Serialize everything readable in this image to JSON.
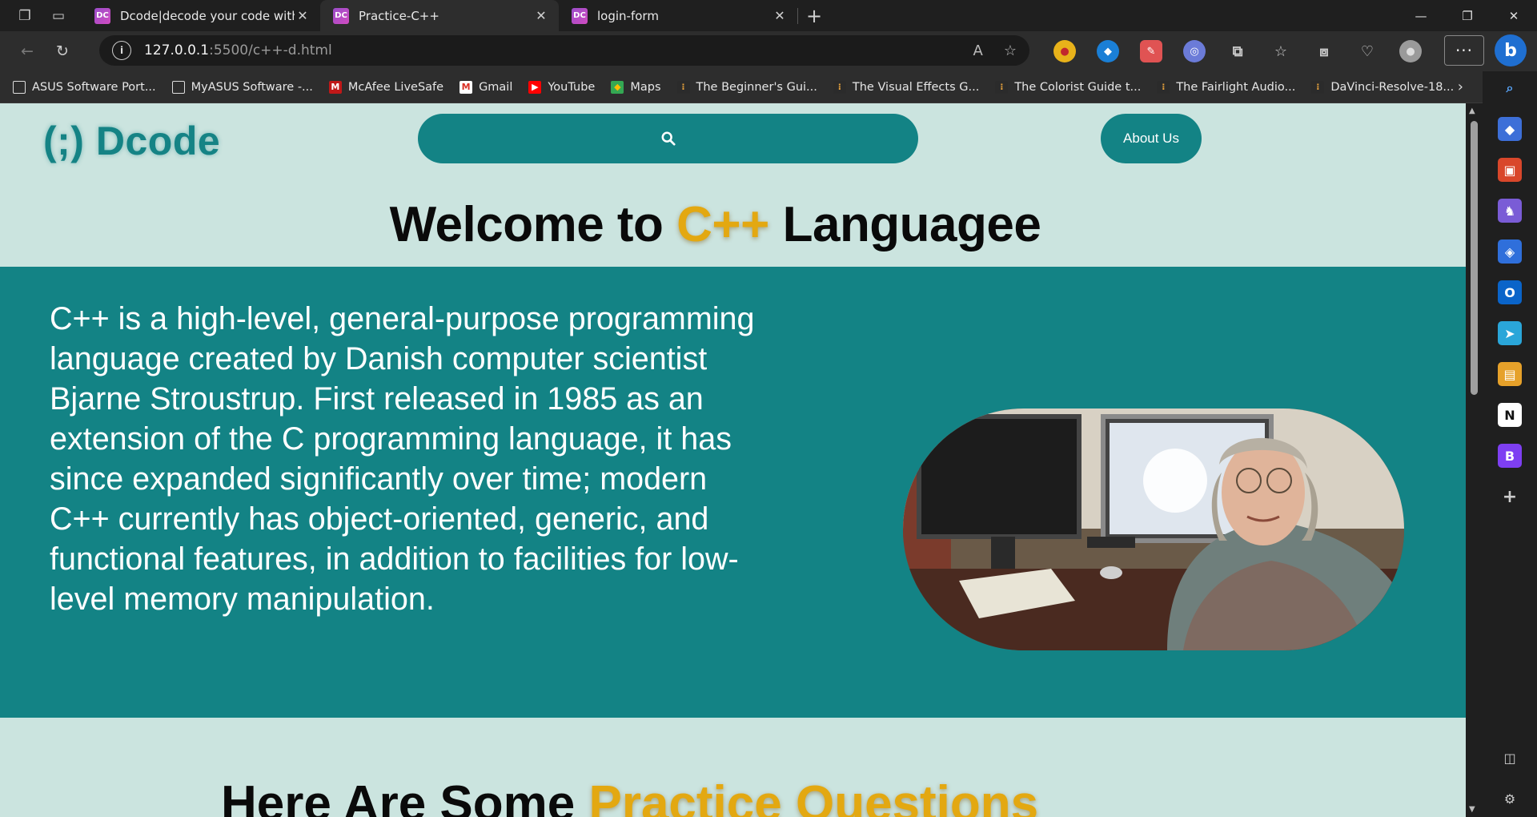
{
  "browser": {
    "tabs": [
      {
        "title": "Dcode|decode your code with yo",
        "favicon": "DC",
        "active": false
      },
      {
        "title": "Practice-C++",
        "favicon": "DC",
        "active": true
      },
      {
        "title": "login-form",
        "favicon": "DC",
        "active": false
      }
    ],
    "url_host": "127.0.0.1",
    "url_path": ":5500/c++-d.html",
    "bookmarks": [
      {
        "label": "ASUS Software Port...",
        "icon": "page-icon"
      },
      {
        "label": "MyASUS Software -...",
        "icon": "page-icon"
      },
      {
        "label": "McAfee LiveSafe",
        "icon": "mcafee-icon"
      },
      {
        "label": "Gmail",
        "icon": "gmail-icon"
      },
      {
        "label": "YouTube",
        "icon": "youtube-icon"
      },
      {
        "label": "Maps",
        "icon": "maps-icon"
      },
      {
        "label": "The Beginner's Gui...",
        "icon": "davinci-icon"
      },
      {
        "label": "The Visual Effects G...",
        "icon": "davinci-icon"
      },
      {
        "label": "The Colorist Guide t...",
        "icon": "davinci-icon"
      },
      {
        "label": "The Fairlight Audio...",
        "icon": "davinci-icon"
      },
      {
        "label": "DaVinci-Resolve-18...",
        "icon": "davinci-icon"
      }
    ]
  },
  "site": {
    "logo_mark": "(;)",
    "logo_text": "Dcode",
    "about_label": "About Us",
    "welcome_prefix": "Welcome to ",
    "welcome_highlight": "C++",
    "welcome_suffix": " Languagee",
    "intro_text": "C++ is a high-level, general-purpose programming language created by Danish computer scientist Bjarne Stroustrup. First released in 1985 as an extension of the C programming language, it has since expanded significantly over time; modern C++ currently has object-oriented, generic, and functional features, in addition to facilities for low-level memory manipulation.",
    "practice_prefix": "Here Are Some ",
    "practice_highlight": "Practice Questions"
  },
  "colors": {
    "brand_teal": "#138385",
    "page_bg": "#cbe4df",
    "highlight_gold": "#e3a811"
  }
}
